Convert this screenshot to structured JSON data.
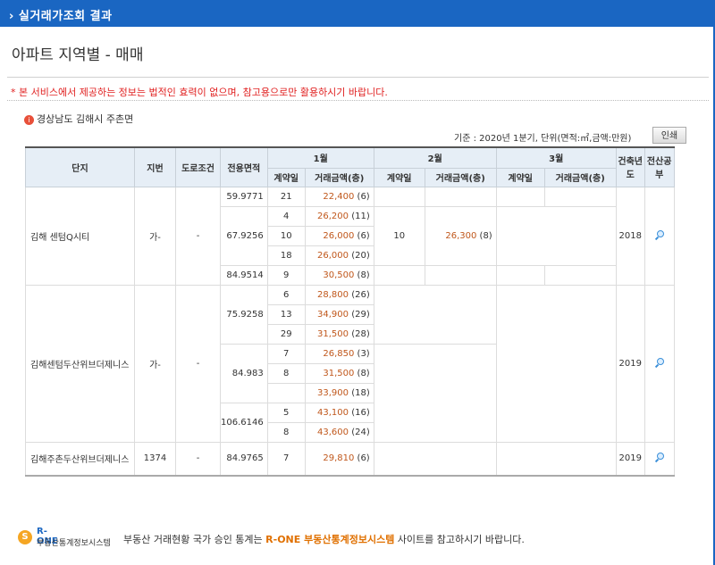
{
  "header": {
    "title": "› 실거래가조회 결과"
  },
  "page": {
    "heading": "아파트 지역별 - 매매"
  },
  "notice": "* 본 서비스에서 제공하는 정보는 법적인 효력이 없으며, 참고용으로만 활용하시기 바랍니다.",
  "region": {
    "icon": "info-icon",
    "text": "경상남도 김해시 주촌면"
  },
  "basis": "기준 : 2020년 1분기, 단위(면적:㎡,금액:만원)",
  "print_label": "인쇄",
  "table": {
    "headers": {
      "complex": "단지",
      "lot": "지번",
      "road": "도로조건",
      "area": "전용면적",
      "m1": "1월",
      "m2": "2월",
      "m3": "3월",
      "contract_day": "계약일",
      "amount": "거래금액(층)",
      "built": "건축년도",
      "cadastre": "전산공부"
    },
    "complexes": [
      {
        "name": "김해 센텀Q시티",
        "lot": "가-",
        "road": "-",
        "built": "2018",
        "areas": [
          "59.9771",
          "67.9256",
          "84.9514"
        ],
        "m1": [
          {
            "day": "21",
            "amount": "22,400",
            "floor": "(6)"
          },
          {
            "day": "4",
            "amount": "26,200",
            "floor": "(11)"
          },
          {
            "day": "10",
            "amount": "26,000",
            "floor": "(6)"
          },
          {
            "day": "18",
            "amount": "26,000",
            "floor": "(20)"
          },
          {
            "day": "9",
            "amount": "30,500",
            "floor": "(8)"
          }
        ],
        "m2": [
          {
            "day": "10",
            "amount": "26,300",
            "floor": "(8)"
          }
        ]
      },
      {
        "name": "김해센텀두산위브더제니스",
        "lot": "가-",
        "road": "-",
        "built": "2019",
        "areas": [
          "75.9258",
          "84.983",
          "106.6146"
        ],
        "m1": [
          {
            "day": "6",
            "amount": "28,800",
            "floor": "(26)"
          },
          {
            "day": "13",
            "amount": "34,900",
            "floor": "(29)"
          },
          {
            "day": "29",
            "amount": "31,500",
            "floor": "(28)"
          },
          {
            "day": "7",
            "amount": "26,850",
            "floor": "(3)"
          },
          {
            "day": "8",
            "amount": "31,500",
            "floor": "(8)"
          },
          {
            "day": "",
            "amount": "33,900",
            "floor": "(18)"
          },
          {
            "day": "5",
            "amount": "43,100",
            "floor": "(16)"
          },
          {
            "day": "8",
            "amount": "43,600",
            "floor": "(24)"
          }
        ]
      },
      {
        "name": "김해주촌두산위브더제니스",
        "lot": "1374",
        "road": "-",
        "built": "2019",
        "areas": [
          "84.9765"
        ],
        "m1": [
          {
            "day": "7",
            "amount": "29,810",
            "floor": "(6)"
          }
        ]
      }
    ]
  },
  "footer": {
    "logo_top": "R-ONE",
    "logo_bottom": "부동산통계정보시스템",
    "text_before": "부동산 거래현황 국가 승인 통계는 ",
    "highlight": "R-ONE 부동산통계정보시스템",
    "text_after": " 사이트를 참고하시기 바랍니다."
  }
}
